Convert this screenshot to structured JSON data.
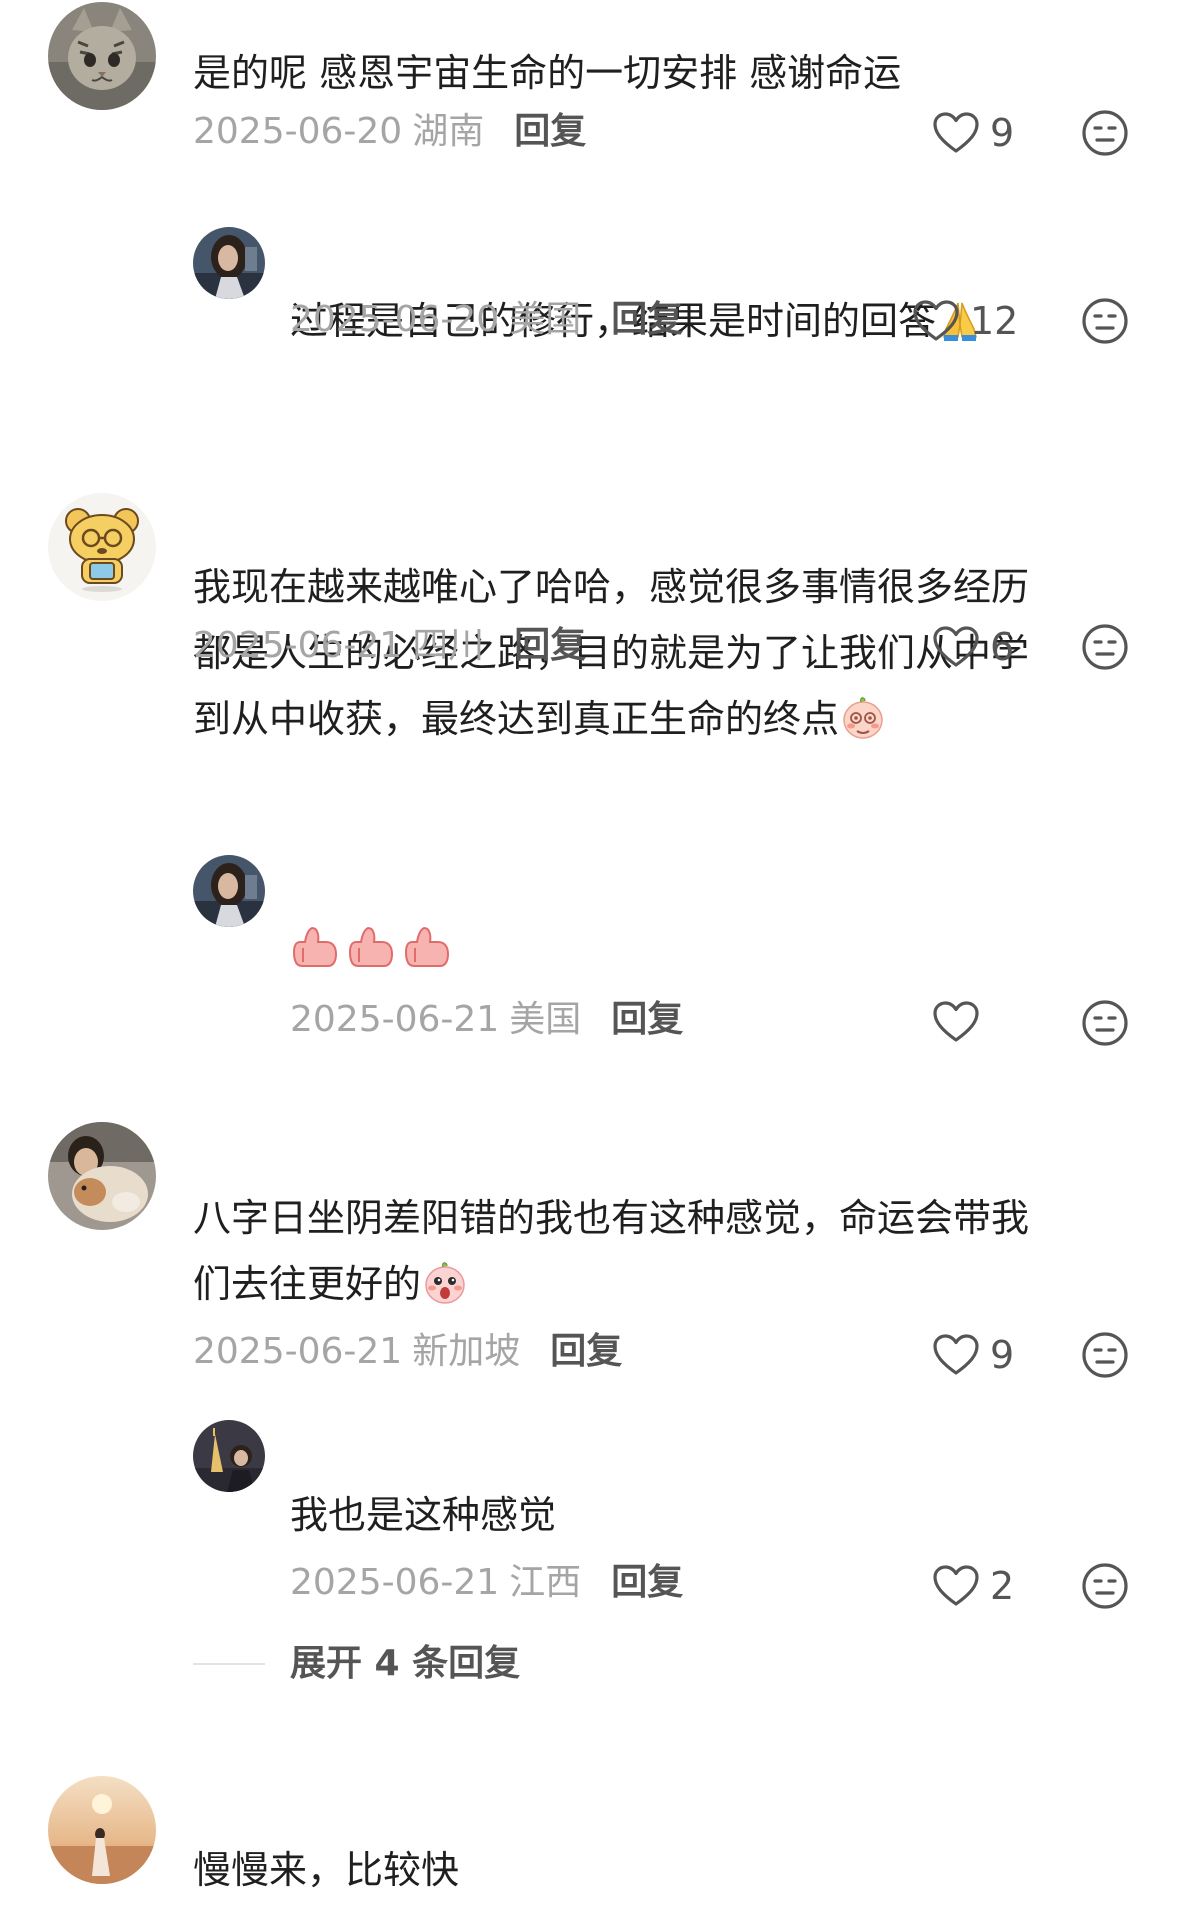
{
  "comments": [
    {
      "text_lines": [
        "是的呢 感恩宇宙生命的一切安排 感谢命运"
      ],
      "date": "2025-06-20",
      "location": "湖南",
      "reply_label": "回复",
      "likes": "9",
      "avatar_icon": "cat-avatar-icon"
    },
    {
      "text_lines": [
        "过程是自己的修行，结果是时间的回答"
      ],
      "emoji": "folded-hands-emoji",
      "date": "2025-06-20",
      "location": "美国",
      "reply_label": "回复",
      "likes": "12",
      "avatar_icon": "woman-avatar-icon"
    },
    {
      "text_lines": [
        "我现在越来越唯心了哈哈，感觉很多事情很多经历",
        "都是人生的必经之路，目的就是为了让我们从中学",
        "到从中收获，最终达到真正生命的终点"
      ],
      "emoji": "shy-peach-emoji",
      "date": "2025-06-21",
      "location": "四川",
      "reply_label": "回复",
      "likes": "6",
      "avatar_icon": "bear-avatar-icon"
    },
    {
      "emoji_count": 3,
      "emoji": "thumbs-up-emoji",
      "date": "2025-06-21",
      "location": "美国",
      "reply_label": "回复",
      "likes": "",
      "avatar_icon": "woman-avatar-icon"
    },
    {
      "text_lines": [
        "八字日坐阴差阳错的我也有这种感觉，命运会带我",
        "们去往更好的"
      ],
      "emoji": "surprised-peach-emoji",
      "date": "2025-06-21",
      "location": "新加坡",
      "reply_label": "回复",
      "likes": "9",
      "avatar_icon": "dog-avatar-icon"
    },
    {
      "text_lines": [
        "我也是这种感觉"
      ],
      "date": "2025-06-21",
      "location": "江西",
      "reply_label": "回复",
      "likes": "2",
      "avatar_icon": "tower-avatar-icon"
    },
    {
      "text_lines": [
        "慢慢来，比较快"
      ],
      "avatar_icon": "sunset-avatar-icon"
    }
  ],
  "expand_replies": "展开 4 条回复",
  "colors": {
    "meta_gray": "#a5a5a5",
    "action_gray": "#555555",
    "text": "#1f1f1f",
    "divider": "#e3e3e3"
  }
}
